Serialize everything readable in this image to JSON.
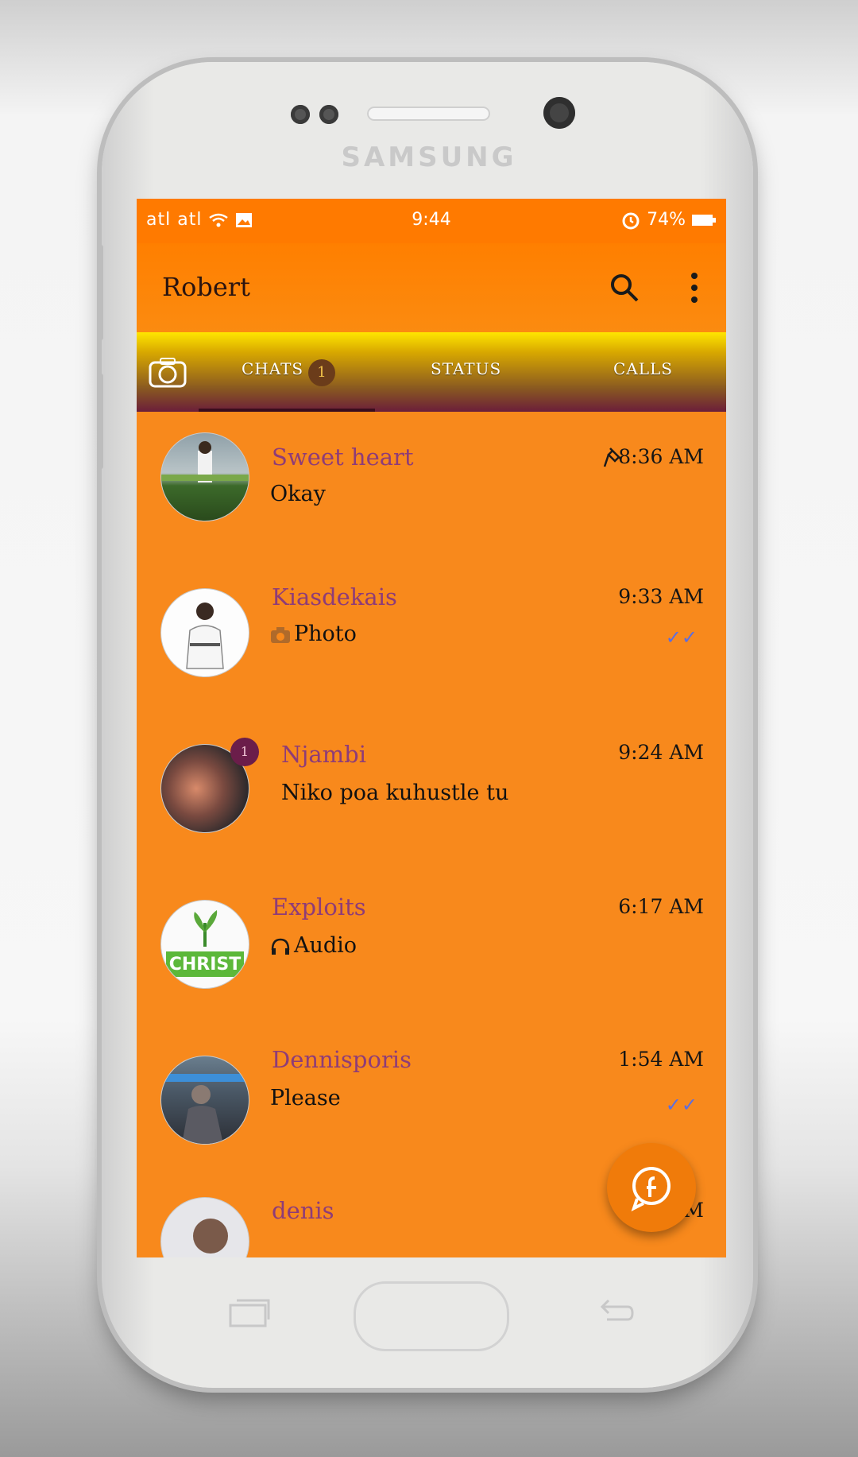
{
  "device": {
    "brand": "SAMSUNG"
  },
  "statusbar": {
    "signal": "atl atl",
    "time": "9:44",
    "battery": "74%"
  },
  "appbar": {
    "title": "Robert",
    "search_icon": "search-icon",
    "menu_icon": "more-vert-icon"
  },
  "tabs": {
    "camera_icon": "camera-icon",
    "chats": "CHATS",
    "chats_badge": "1",
    "status": "STATUS",
    "calls": "CALLS"
  },
  "chats": [
    {
      "name": "Sweet heart",
      "message": "Okay",
      "time": "8:36 AM",
      "pinned": true
    },
    {
      "name": "Kiasdekais",
      "message": "Photo",
      "time": "9:33 AM",
      "message_icon": "camera-icon",
      "ticks": "✓✓"
    },
    {
      "name": "Njambi",
      "message": "Niko poa kuhustle tu",
      "time": "9:24 AM",
      "unread": "1"
    },
    {
      "name": "Exploits",
      "message": "Audio",
      "time": "6:17 AM",
      "message_icon": "headphones-icon",
      "avatar_text": "CHRIST"
    },
    {
      "name": "Dennisporis",
      "message": "Please",
      "time": "1:54 AM",
      "ticks": "✓✓"
    },
    {
      "name": "denis",
      "message": "",
      "time": "1:50 AM"
    }
  ],
  "fab": {
    "icon": "chat-icon"
  },
  "colors": {
    "screen_bg": "#f8891c",
    "statusbar": "#ff7a00",
    "name": "#8e3c78",
    "tabs_top": "#ffe600",
    "tabs_bottom": "#6b1e3a"
  }
}
